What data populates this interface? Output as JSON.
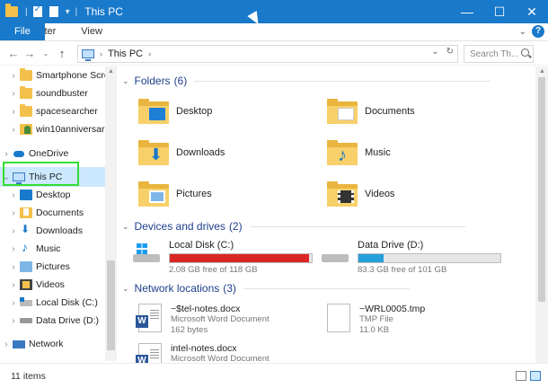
{
  "window": {
    "title": "This PC",
    "accent": "#1979ca"
  },
  "ribbon": {
    "tabs": [
      "File",
      "Computer",
      "View"
    ]
  },
  "address": {
    "crumbs": [
      "This PC"
    ],
    "search_placeholder": "Search Th..."
  },
  "nav": {
    "items": [
      {
        "label": "Smartphone Scre",
        "icon": "folder-icon"
      },
      {
        "label": "soundbuster",
        "icon": "folder-icon"
      },
      {
        "label": "spacesearcher",
        "icon": "folder-icon"
      },
      {
        "label": "win10anniversar",
        "icon": "user-folder-icon"
      },
      {
        "label": "OneDrive",
        "icon": "onedrive-icon"
      },
      {
        "label": "This PC",
        "icon": "computer-icon"
      },
      {
        "label": "Desktop",
        "icon": "desktop-icon"
      },
      {
        "label": "Documents",
        "icon": "documents-icon"
      },
      {
        "label": "Downloads",
        "icon": "downloads-icon"
      },
      {
        "label": "Music",
        "icon": "music-icon"
      },
      {
        "label": "Pictures",
        "icon": "pictures-icon"
      },
      {
        "label": "Videos",
        "icon": "videos-icon"
      },
      {
        "label": "Local Disk (C:)",
        "icon": "local-disk-icon"
      },
      {
        "label": "Data Drive (D:)",
        "icon": "data-drive-icon"
      },
      {
        "label": "Network",
        "icon": "network-icon"
      }
    ]
  },
  "sections": {
    "folders": {
      "title": "Folders",
      "count": "(6)"
    },
    "devices": {
      "title": "Devices and drives",
      "count": "(2)"
    },
    "network": {
      "title": "Network locations",
      "count": "(3)"
    }
  },
  "folders": [
    {
      "label": "Desktop",
      "icon": "desktop-folder-icon"
    },
    {
      "label": "Documents",
      "icon": "documents-folder-icon"
    },
    {
      "label": "Downloads",
      "icon": "downloads-folder-icon"
    },
    {
      "label": "Music",
      "icon": "music-folder-icon"
    },
    {
      "label": "Pictures",
      "icon": "pictures-folder-icon"
    },
    {
      "label": "Videos",
      "icon": "videos-folder-icon"
    }
  ],
  "drives": [
    {
      "name": "Local Disk (C:)",
      "free": "2.08 GB free of 118 GB",
      "used_fraction": 0.98,
      "bar_color": "#da2626"
    },
    {
      "name": "Data Drive (D:)",
      "free": "83.3 GB free of 101 GB",
      "used_fraction": 0.18,
      "bar_color": "#26a0da"
    }
  ],
  "files": [
    {
      "name": "~$tel-notes.docx",
      "type": "Microsoft Word Document",
      "size": "162 bytes",
      "icon": "word-document-icon"
    },
    {
      "name": "~WRL0005.tmp",
      "type": "TMP File",
      "size": "11.0 KB",
      "icon": "blank-file-icon"
    },
    {
      "name": "intel-notes.docx",
      "type": "Microsoft Word Document",
      "size": "",
      "icon": "word-document-icon"
    }
  ],
  "status": {
    "items": "11 items"
  }
}
